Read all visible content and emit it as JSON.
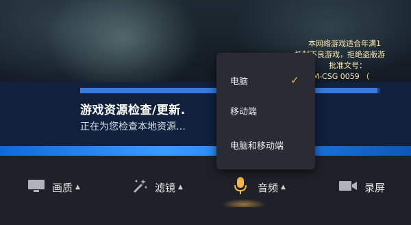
{
  "notice": {
    "line1": "本网络游戏适合年满1",
    "line2": "抵制不良游戏，拒绝盗版游",
    "line3": "批准文号：",
    "line4": "[2016]M-CSG 0059 （"
  },
  "progress": {
    "title": "游戏资源检查/更新.",
    "subtitle": "正在为您检查本地资源…",
    "fraction": 0.99
  },
  "toolbar": {
    "quality_label": "画质",
    "filter_label": "滤镜",
    "audio_label": "音频",
    "record_label": "录屏",
    "caret": "▲"
  },
  "audio_menu": {
    "options": [
      "电脑",
      "移动端",
      "电脑和移动端"
    ],
    "selected": "电脑",
    "check": "✓"
  },
  "colors": {
    "accent": "#f2b84b",
    "menu_bg": "#2b2c33",
    "toolbar_bg": "#1f2128"
  },
  "icons": {
    "quality": "monitor-icon",
    "filter": "magic-wand-icon",
    "audio": "microphone-icon",
    "record": "video-camera-icon"
  }
}
